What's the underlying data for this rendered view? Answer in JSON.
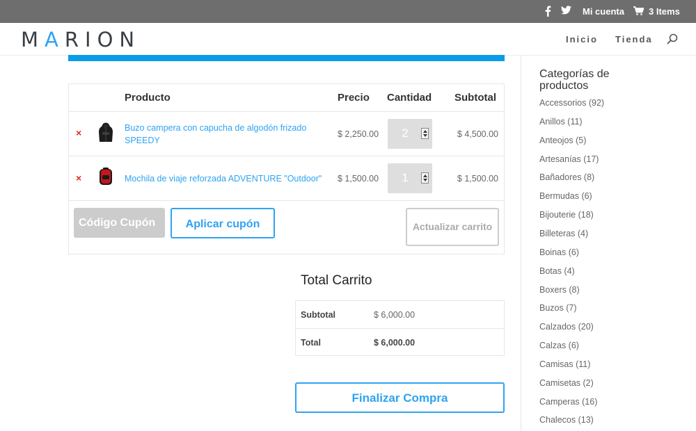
{
  "topbar": {
    "account_label": "Mi cuenta",
    "cart_label": "3 Items"
  },
  "header": {
    "logo_left": "M",
    "logo_accent": "A",
    "logo_right": "RION",
    "nav": [
      {
        "label": "Inicio"
      },
      {
        "label": "Tienda"
      }
    ]
  },
  "cart": {
    "headers": {
      "product": "Producto",
      "price": "Precio",
      "quantity": "Cantidad",
      "subtotal": "Subtotal"
    },
    "items": [
      {
        "name": "Buzo campera con capucha de algodón frizado SPEEDY",
        "price": "$ 2,250.00",
        "quantity": "2",
        "subtotal": "$ 4,500.00"
      },
      {
        "name": "Mochila de viaje reforzada ADVENTURE \"Outdoor\"",
        "price": "$ 1,500.00",
        "quantity": "1",
        "subtotal": "$ 1,500.00"
      }
    ],
    "remove_symbol": "×",
    "coupon_placeholder": "Código Cupón",
    "apply_coupon_label": "Aplicar cupón",
    "update_cart_label": "Actualizar carrito"
  },
  "totals": {
    "title": "Total Carrito",
    "subtotal_label": "Subtotal",
    "subtotal_value": "$ 6,000.00",
    "total_label": "Total",
    "total_value": "$ 6,000.00",
    "checkout_label": "Finalizar Compra"
  },
  "sidebar": {
    "title": "Categorías de productos",
    "categories": [
      "Accessorios (92)",
      "Anillos (11)",
      "Anteojos (5)",
      "Artesanías (17)",
      "Bañadores (8)",
      "Bermudas (6)",
      "Bijouterie (18)",
      "Billeteras (4)",
      "Boinas (6)",
      "Botas (4)",
      "Boxers (8)",
      "Buzos (7)",
      "Calzados (20)",
      "Calzas (6)",
      "Camisas (11)",
      "Camisetas (2)",
      "Camperas (16)",
      "Chalecos (13)"
    ]
  },
  "colors": {
    "accent": "#2ea3f2",
    "progress_bar": "#0c9be8",
    "topbar": "#6e6e6e",
    "remove": "#e02b20"
  }
}
